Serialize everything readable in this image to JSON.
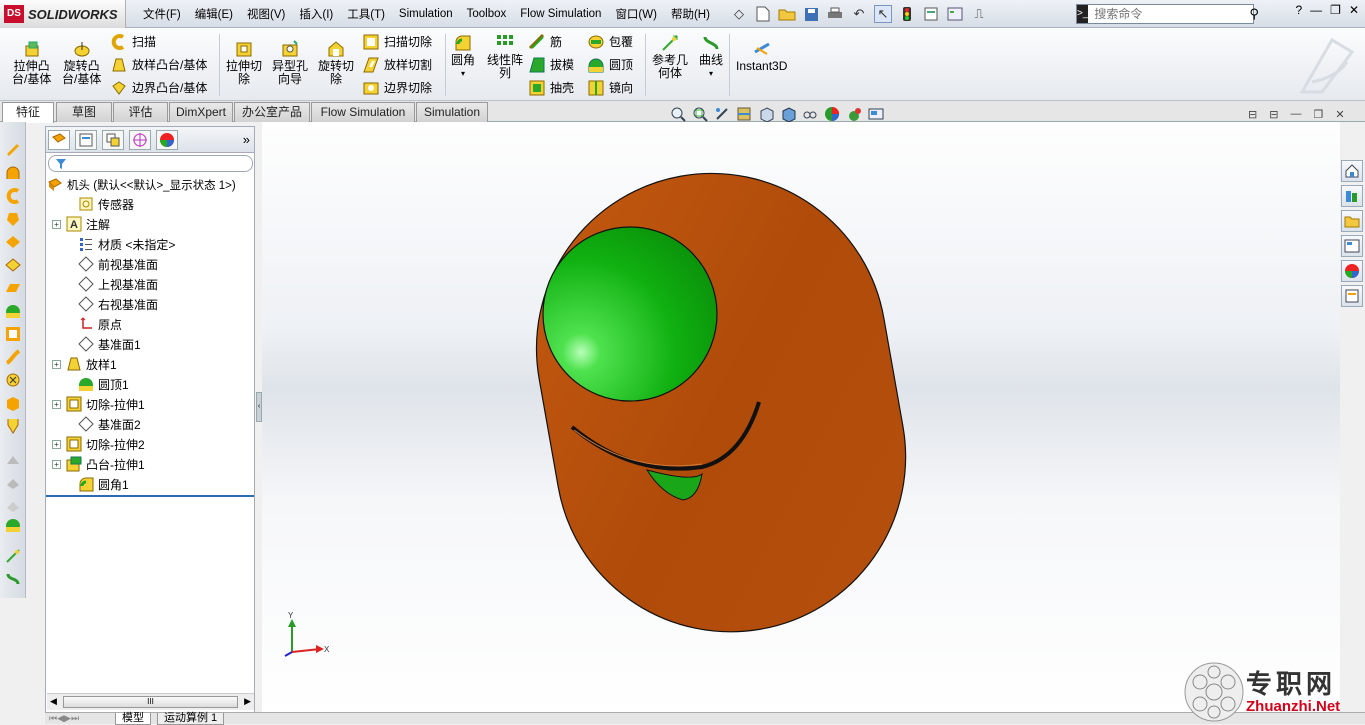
{
  "app": {
    "brand": "SOLIDWORKS",
    "logo": "DS"
  },
  "menu": [
    "文件(F)",
    "编辑(E)",
    "视图(V)",
    "插入(I)",
    "工具(T)",
    "Simulation",
    "Toolbox",
    "Flow Simulation",
    "窗口(W)",
    "帮助(H)"
  ],
  "search": {
    "placeholder": "搜索命令"
  },
  "ribbon": {
    "extrude_boss": [
      "拉伸凸",
      "台/基体"
    ],
    "revolve_boss": [
      "旋转凸",
      "台/基体"
    ],
    "sweep": "扫描",
    "loft": "放样凸台/基体",
    "boundary": "边界凸台/基体",
    "extrude_cut": [
      "拉伸切",
      "除"
    ],
    "hole_wizard": [
      "异型孔",
      "向导"
    ],
    "revolve_cut": [
      "旋转切",
      "除"
    ],
    "sweep_cut": "扫描切除",
    "loft_cut": "放样切割",
    "boundary_cut": "边界切除",
    "fillet": "圆角",
    "linear_pattern": [
      "线性阵",
      "列"
    ],
    "rib": "筋",
    "draft": "拔模",
    "shell": "抽壳",
    "wrap": "包覆",
    "dome": "圆顶",
    "mirror": "镜向",
    "ref_geometry": [
      "参考几",
      "何体"
    ],
    "curves": "曲线",
    "instant3d": "Instant3D"
  },
  "tabs": [
    "特征",
    "草图",
    "评估",
    "DimXpert",
    "办公室产品",
    "Flow Simulation",
    "Simulation"
  ],
  "tree": {
    "root": "机头 (默认<<默认>_显示状态 1>)",
    "items": [
      "传感器",
      "注解",
      "材质 <未指定>",
      "前视基准面",
      "上视基准面",
      "右视基准面",
      "原点",
      "基准面1",
      "放样1",
      "圆顶1",
      "切除-拉伸1",
      "基准面2",
      "切除-拉伸2",
      "凸台-拉伸1",
      "圆角1"
    ]
  },
  "scroll_grip": "III",
  "bottom_tabs": [
    "模型",
    "运动算例 1"
  ],
  "axes": {
    "x": "X",
    "y": "Y"
  },
  "watermark": {
    "text": "专职网",
    "url": "Zhuanzhi.Net"
  },
  "colors": {
    "body": "#c5560f",
    "eye": "#1fbf1f",
    "accent": "#f5a300"
  }
}
